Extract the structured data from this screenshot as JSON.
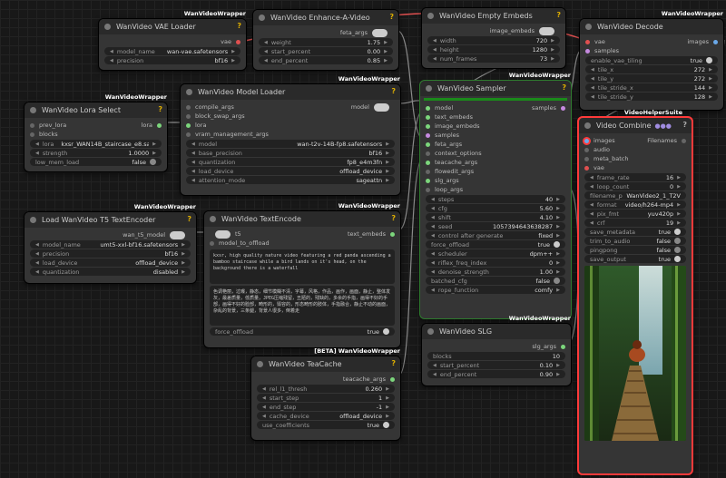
{
  "nodes": {
    "vae_loader": {
      "title": "WanVideo VAE Loader",
      "badge": "WanVideoWrapper",
      "output": "vae",
      "widgets": [
        {
          "label": "model_name",
          "value": "wan-vae.safetensors"
        },
        {
          "label": "precision",
          "value": "bf16"
        }
      ]
    },
    "enhance": {
      "title": "WanVideo Enhance-A-Video",
      "output": "feta_args",
      "widgets": [
        {
          "label": "weight",
          "value": "1.75"
        },
        {
          "label": "start_percent",
          "value": "0.00"
        },
        {
          "label": "end_percent",
          "value": "0.85"
        }
      ]
    },
    "empty_embeds": {
      "title": "WanVideo Empty Embeds",
      "output": "image_embeds",
      "widgets": [
        {
          "label": "width",
          "value": "720"
        },
        {
          "label": "height",
          "value": "1280"
        },
        {
          "label": "num_frames",
          "value": "73"
        }
      ]
    },
    "decode": {
      "title": "WanVideo Decode",
      "badge": "WanVideoWrapper",
      "inputs": [
        "vae",
        "samples"
      ],
      "output": "images",
      "widgets": [
        {
          "label": "enable_vae_tiling",
          "value": "true"
        },
        {
          "label": "tile_x",
          "value": "272"
        },
        {
          "label": "tile_y",
          "value": "272"
        },
        {
          "label": "tile_stride_x",
          "value": "144"
        },
        {
          "label": "tile_stride_y",
          "value": "128"
        }
      ]
    },
    "lora": {
      "title": "WanVideo Lora Select",
      "badge": "WanVideoWrapper",
      "inputs": [
        "prev_lora",
        "blocks"
      ],
      "output": "lora",
      "widgets": [
        {
          "label": "lora",
          "value": "kxsr_WAN14B_staircase_e8.safete..."
        },
        {
          "label": "strength",
          "value": "1.0000"
        },
        {
          "label": "low_mem_load",
          "value": "false"
        }
      ]
    },
    "model_loader": {
      "title": "WanVideo Model Loader",
      "badge": "WanVideoWrapper",
      "inputs": [
        "compile_args",
        "block_swap_args",
        "lora",
        "vram_management_args"
      ],
      "output": "model",
      "widgets": [
        {
          "label": "model",
          "value": "wan-t2v-14B-fp8.safetensors"
        },
        {
          "label": "base_precision",
          "value": "bf16"
        },
        {
          "label": "quantization",
          "value": "fp8_e4m3fn"
        },
        {
          "label": "load_device",
          "value": "offload_device"
        },
        {
          "label": "attention_mode",
          "value": "sageattn"
        }
      ]
    },
    "sampler": {
      "title": "WanVideo Sampler",
      "badge": "WanVideoWrapper",
      "output": "samples",
      "inputs": [
        "model",
        "text_embeds",
        "image_embeds",
        "samples",
        "feta_args",
        "context_options",
        "teacache_args",
        "flowedit_args",
        "slg_args",
        "loop_args"
      ],
      "widgets": [
        {
          "label": "steps",
          "value": "40"
        },
        {
          "label": "cfg",
          "value": "5.60"
        },
        {
          "label": "shift",
          "value": "4.10"
        },
        {
          "label": "seed",
          "value": "1057394643638287"
        },
        {
          "label": "control after generate",
          "value": "fixed"
        },
        {
          "label": "force_offload",
          "value": "true"
        },
        {
          "label": "scheduler",
          "value": "dpm++"
        },
        {
          "label": "riflex_freq_index",
          "value": "0"
        },
        {
          "label": "denoise_strength",
          "value": "1.00"
        },
        {
          "label": "batched_cfg",
          "value": "false"
        },
        {
          "label": "rope_function",
          "value": "comfy"
        }
      ]
    },
    "t5_loader": {
      "title": "Load WanVideo T5 TextEncoder",
      "badge": "WanVideoWrapper",
      "output": "wan_t5_model",
      "widgets": [
        {
          "label": "model_name",
          "value": "umt5-xxl-bf16.safetensors"
        },
        {
          "label": "precision",
          "value": "bf16"
        },
        {
          "label": "load_device",
          "value": "offload_device"
        },
        {
          "label": "quantization",
          "value": "disabled"
        }
      ]
    },
    "text_encode": {
      "title": "WanVideo TextEncode",
      "badge": "WanVideoWrapper",
      "inputs": [
        "t5",
        "model_to_offload"
      ],
      "output": "text_embeds",
      "positive": "kxsr, high quality nature video featuring a red panda ascending a bamboo staircase while a bird lands on it's head, on the background there is a waterfall",
      "negative": "色调艳丽，过曝，静态，细节模糊不清，字幕，风格，作品，画作，画面，静止，整体发灰，最差质量，低质量，JPEG压缩残留，丑陋的，残缺的，多余的手指，画得不好的手部，画得不好的脸部，畸形的，毁容的，形态畸形的肢体，手指融合，静止不动的画面，杂乱的背景，三条腿，背景人很多，倒着走",
      "widgets": [
        {
          "label": "force_offload",
          "value": "true"
        }
      ]
    },
    "teacache": {
      "title": "WanVideo TeaCache",
      "badge": "[BETA] WanVideoWrapper",
      "output": "teacache_args",
      "widgets": [
        {
          "label": "rel_l1_thresh",
          "value": "0.260"
        },
        {
          "label": "start_step",
          "value": "1"
        },
        {
          "label": "end_step",
          "value": "-1"
        },
        {
          "label": "cache_device",
          "value": "offload_device"
        },
        {
          "label": "use_coefficients",
          "value": "true"
        }
      ]
    },
    "slg": {
      "title": "WanVideo SLG",
      "badge": "WanVideoWrapper",
      "output": "slg_args",
      "widgets": [
        {
          "label": "blocks",
          "value": "10"
        },
        {
          "label": "start_percent",
          "value": "0.10"
        },
        {
          "label": "end_percent",
          "value": "0.90"
        }
      ]
    },
    "combine": {
      "title": "Video Combine",
      "badge": "VideoHelperSuite",
      "inputs": [
        "images",
        "audio",
        "meta_batch",
        "vae"
      ],
      "output": "Filenames",
      "widgets": [
        {
          "label": "frame_rate",
          "value": "16"
        },
        {
          "label": "loop_count",
          "value": "0"
        },
        {
          "label": "filename_prefix",
          "value": "WanVideo2_1_T2V"
        },
        {
          "label": "format",
          "value": "video/h264-mp4"
        },
        {
          "label": "pix_fmt",
          "value": "yuv420p"
        },
        {
          "label": "crf",
          "value": "19"
        },
        {
          "label": "save_metadata",
          "value": "true"
        },
        {
          "label": "trim_to_audio",
          "value": "false"
        },
        {
          "label": "pingpong",
          "value": "false"
        },
        {
          "label": "save_output",
          "value": "true"
        }
      ]
    }
  },
  "colors": {
    "selected": "#ff3a3a",
    "progress": "#1a8a1a",
    "accent_question": "#e0b000"
  }
}
